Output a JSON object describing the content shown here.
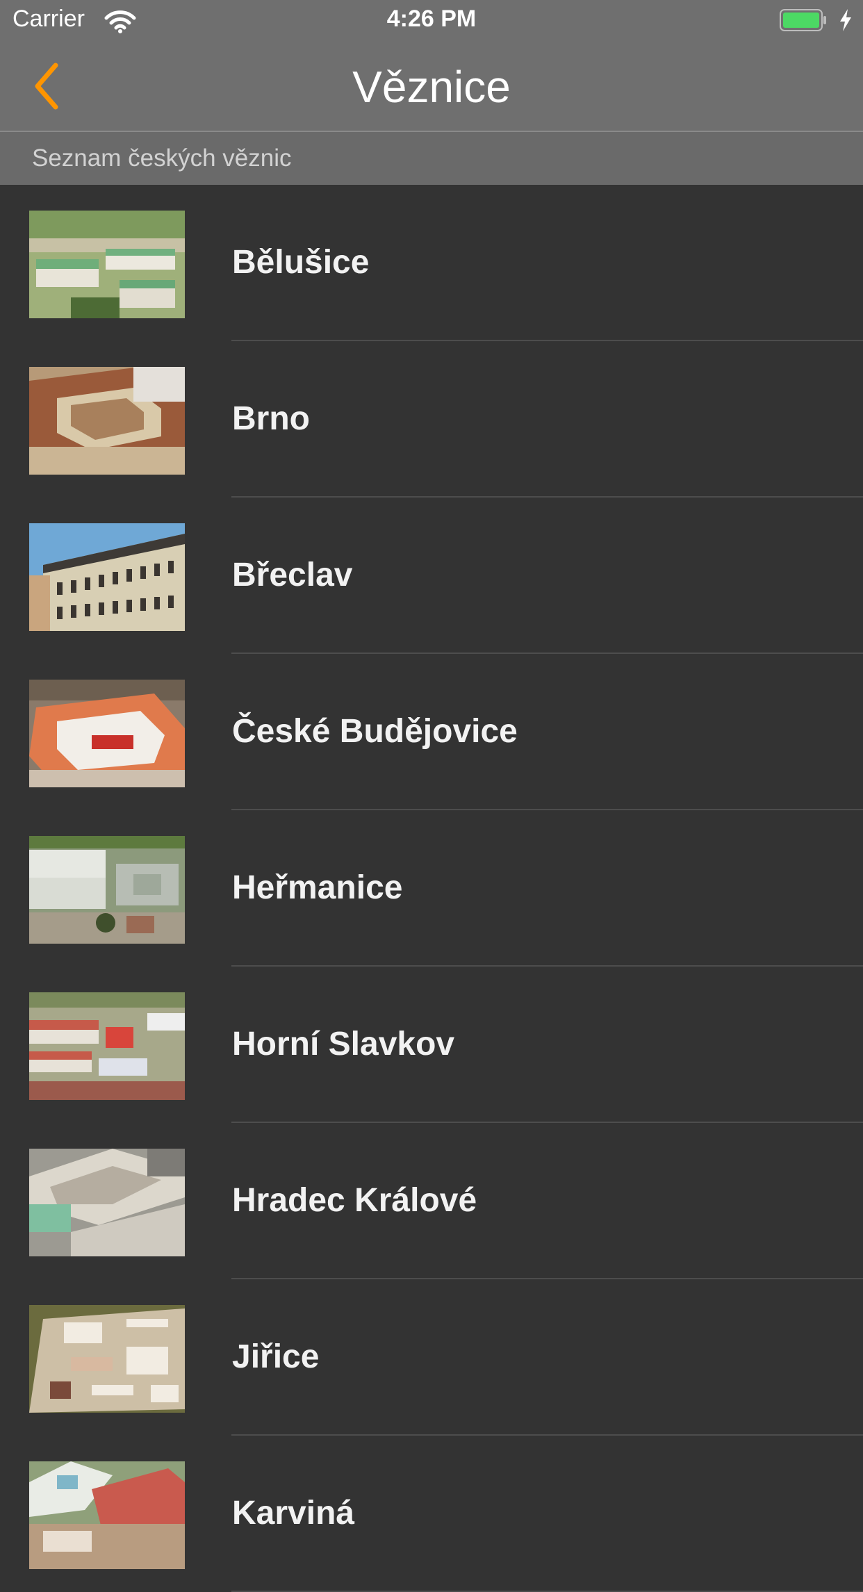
{
  "status_bar": {
    "carrier": "Carrier",
    "time": "4:26 PM",
    "battery_color": "#4cd964"
  },
  "nav": {
    "title": "Věznice",
    "back_icon": "chevron-left-icon",
    "accent_color": "#ff9500"
  },
  "section": {
    "label": "Seznam českých věznic"
  },
  "prisons": [
    {
      "name": "Bělušice"
    },
    {
      "name": "Brno"
    },
    {
      "name": "Břeclav"
    },
    {
      "name": "České Budějovice"
    },
    {
      "name": "Heřmanice"
    },
    {
      "name": "Horní Slavkov"
    },
    {
      "name": "Hradec Králové"
    },
    {
      "name": "Jiřice"
    },
    {
      "name": "Karviná"
    }
  ]
}
